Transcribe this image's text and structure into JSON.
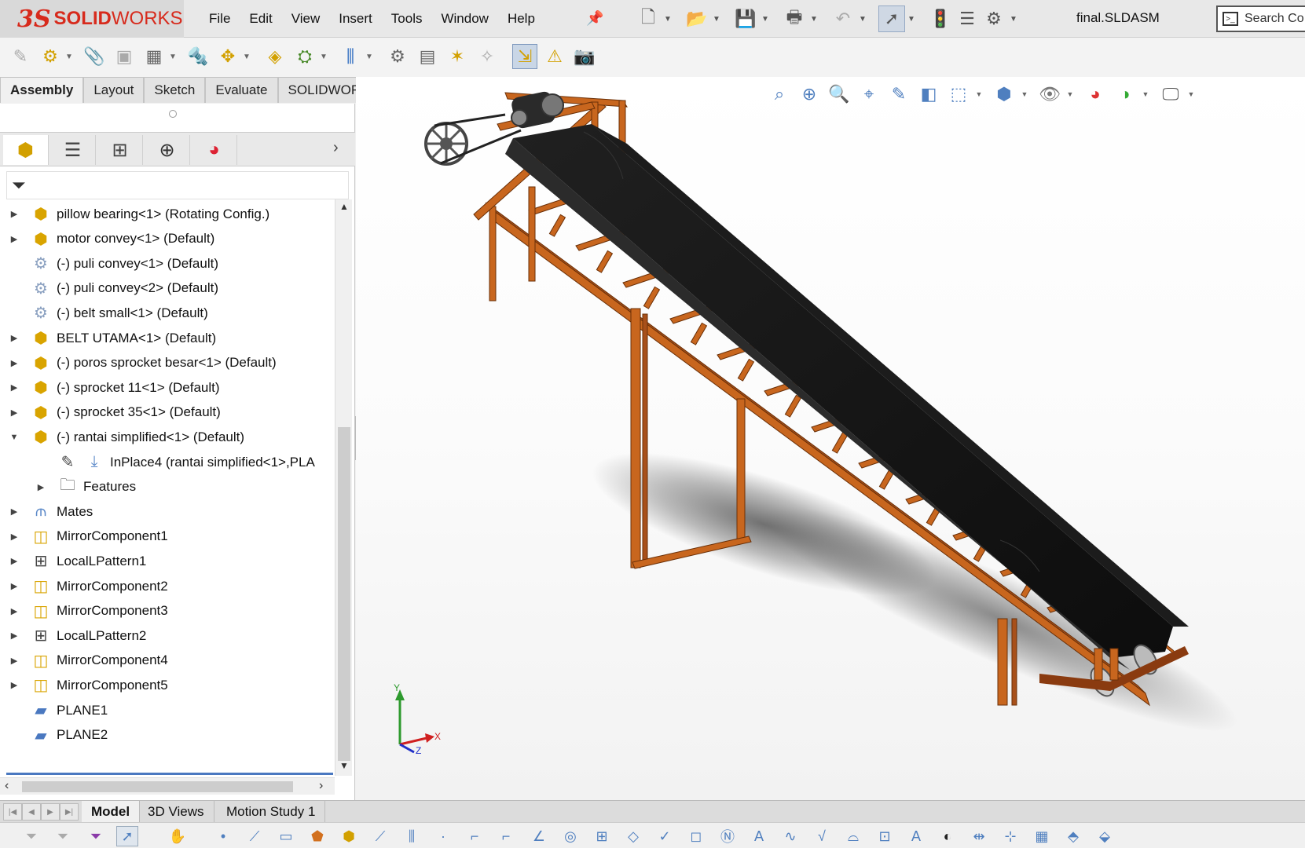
{
  "app": {
    "logo_mark": "3S",
    "logo_solid": "SOLID",
    "logo_works": "WORKS",
    "document_title": "final.SLDASM",
    "search_placeholder": "Search Co"
  },
  "menu": [
    "File",
    "Edit",
    "View",
    "Insert",
    "Tools",
    "Window",
    "Help"
  ],
  "command_tabs": [
    "Assembly",
    "Layout",
    "Sketch",
    "Evaluate",
    "SOLIDWORKS Add-Ins"
  ],
  "active_command_tab": "Assembly",
  "feature_tree": [
    {
      "label": "pillow bearing<1> (Rotating Config.)",
      "icon": "part-icon",
      "expand": "right",
      "indent": 0
    },
    {
      "label": "motor convey<1> (Default)",
      "icon": "part-icon",
      "expand": "right",
      "indent": 0
    },
    {
      "label": "(-) puli convey<1> (Default)",
      "icon": "subassembly-icon",
      "expand": "",
      "indent": 0
    },
    {
      "label": "(-) puli convey<2> (Default)",
      "icon": "subassembly-icon",
      "expand": "",
      "indent": 0
    },
    {
      "label": "(-) belt small<1> (Default)",
      "icon": "subassembly-icon",
      "expand": "",
      "indent": 0
    },
    {
      "label": "BELT UTAMA<1> (Default)",
      "icon": "part-icon",
      "expand": "right",
      "indent": 0
    },
    {
      "label": "(-) poros sprocket besar<1> (Default)",
      "icon": "part-icon",
      "expand": "right",
      "indent": 0
    },
    {
      "label": "(-) sprocket 11<1> (Default)",
      "icon": "part-icon",
      "expand": "right",
      "indent": 0
    },
    {
      "label": "(-) sprocket 35<1> (Default)",
      "icon": "part-icon",
      "expand": "right",
      "indent": 0
    },
    {
      "label": "(-) rantai simplified<1> (Default)",
      "icon": "part-icon",
      "expand": "down",
      "indent": 0
    },
    {
      "label": "InPlace4 (rantai simplified<1>,PLA",
      "icon": "inplace-icon",
      "expand": "",
      "indent": 1
    },
    {
      "label": "Features",
      "icon": "features-folder-icon",
      "expand": "right",
      "indent": 1
    },
    {
      "label": "Mates",
      "icon": "mates-icon",
      "expand": "right",
      "indent": 0
    },
    {
      "label": "MirrorComponent1",
      "icon": "mirror-component-icon",
      "expand": "right",
      "indent": 0
    },
    {
      "label": "LocalLPattern1",
      "icon": "linear-pattern-icon",
      "expand": "right",
      "indent": 0
    },
    {
      "label": "MirrorComponent2",
      "icon": "mirror-component-icon",
      "expand": "right",
      "indent": 0
    },
    {
      "label": "MirrorComponent3",
      "icon": "mirror-component-icon",
      "expand": "right",
      "indent": 0
    },
    {
      "label": "LocalLPattern2",
      "icon": "linear-pattern-icon",
      "expand": "right",
      "indent": 0
    },
    {
      "label": "MirrorComponent4",
      "icon": "mirror-component-icon",
      "expand": "right",
      "indent": 0
    },
    {
      "label": "MirrorComponent5",
      "icon": "mirror-component-icon",
      "expand": "right",
      "indent": 0
    },
    {
      "label": "PLANE1",
      "icon": "plane-icon",
      "expand": "",
      "indent": 0
    },
    {
      "label": "PLANE2",
      "icon": "plane-icon",
      "expand": "",
      "indent": 0
    }
  ],
  "bottom_tabs": [
    "Model",
    "3D Views",
    "Motion Study 1"
  ],
  "active_bottom_tab": "Model",
  "triad": {
    "x": "X",
    "y": "Y",
    "z": "Z"
  },
  "colors": {
    "frame_orange": "#c8661e",
    "belt_black": "#161616",
    "brand_red": "#d72a1c",
    "accent_blue": "#4a78c0"
  }
}
